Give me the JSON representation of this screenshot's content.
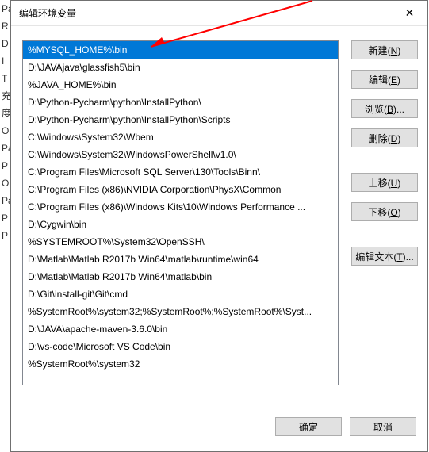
{
  "window": {
    "title": "编辑环境变量",
    "close_glyph": "✕"
  },
  "list": {
    "items": [
      "%MYSQL_HOME%\\bin",
      "D:\\JAVAjava\\glassfish5\\bin",
      "%JAVA_HOME%\\bin",
      "D:\\Python-Pycharm\\python\\InstallPython\\",
      "D:\\Python-Pycharm\\python\\InstallPython\\Scripts",
      "C:\\Windows\\System32\\Wbem",
      "C:\\Windows\\System32\\WindowsPowerShell\\v1.0\\",
      "C:\\Program Files\\Microsoft SQL Server\\130\\Tools\\Binn\\",
      "C:\\Program Files (x86)\\NVIDIA Corporation\\PhysX\\Common",
      "C:\\Program Files (x86)\\Windows Kits\\10\\Windows Performance ...",
      "D:\\Cygwin\\bin",
      "%SYSTEMROOT%\\System32\\OpenSSH\\",
      "D:\\Matlab\\Matlab R2017b Win64\\matlab\\runtime\\win64",
      "D:\\Matlab\\Matlab R2017b Win64\\matlab\\bin",
      "D:\\Git\\install-git\\Git\\cmd",
      "%SystemRoot%\\system32;%SystemRoot%;%SystemRoot%\\Syst...",
      "D:\\JAVA\\apache-maven-3.6.0\\bin",
      "D:\\vs-code\\Microsoft VS Code\\bin",
      "%SystemRoot%\\system32"
    ],
    "selected_index": 0
  },
  "buttons": {
    "new": "新建(N)",
    "edit": "编辑(E)",
    "browse": "浏览(B)...",
    "delete": "删除(D)",
    "move_up": "上移(U)",
    "move_down": "下移(O)",
    "edit_text": "编辑文本(T)...",
    "ok": "确定",
    "cancel": "取消"
  },
  "behind_chars": [
    "",
    "",
    "",
    "Pa",
    "R",
    "D",
    "I",
    "T",
    "",
    "",
    "",
    "",
    "充",
    "度",
    "O",
    "Pa",
    "P",
    "O",
    "Pa",
    "P",
    "P"
  ],
  "colors": {
    "selection": "#0078d7",
    "button_bg": "#e1e1e1",
    "arrow": "#ff0000"
  }
}
